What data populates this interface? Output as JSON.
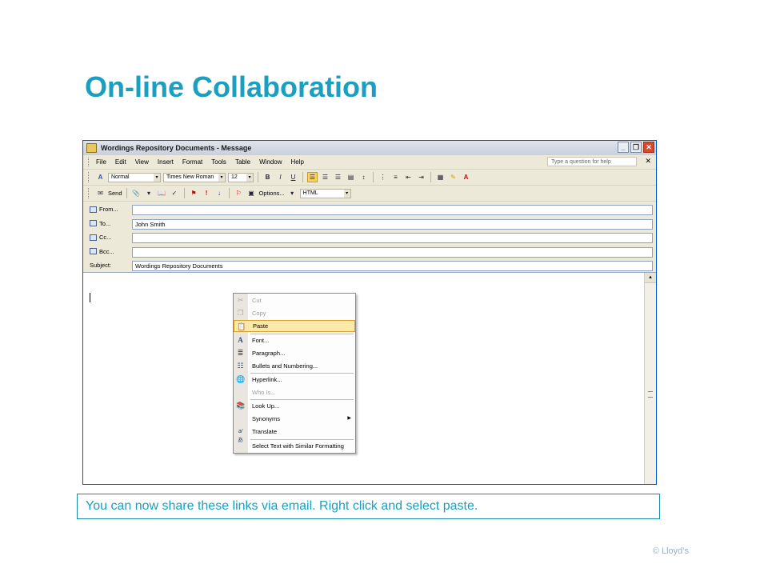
{
  "slide": {
    "title": "On-line Collaboration",
    "caption": "You can now share these links via email. Right click and select paste.",
    "footer": "© Lloyd’s"
  },
  "window": {
    "title": "Wordings Repository Documents - Message",
    "menu": [
      "File",
      "Edit",
      "View",
      "Insert",
      "Format",
      "Tools",
      "Table",
      "Window",
      "Help"
    ],
    "help_placeholder": "Type a question for help",
    "format_toolbar": {
      "style": "Normal",
      "font": "Times New Roman",
      "size": "12",
      "bold": "B",
      "italic": "I",
      "underline": "U"
    },
    "send_toolbar": {
      "send": "Send",
      "options": "Options...",
      "format": "HTML"
    },
    "fields": {
      "from_label": "From...",
      "from_value": "",
      "to_label": "To...",
      "to_value": "John Smith",
      "cc_label": "Cc...",
      "cc_value": "",
      "bcc_label": "Bcc...",
      "bcc_value": "",
      "subject_label": "Subject:",
      "subject_value": "Wordings Repository Documents"
    }
  },
  "context_menu": {
    "items": [
      {
        "label": "Cut",
        "icon": "scissors-icon",
        "enabled": false
      },
      {
        "label": "Copy",
        "icon": "copy-icon",
        "enabled": false
      },
      {
        "label": "Paste",
        "icon": "paste-icon",
        "enabled": true,
        "highlighted": true
      },
      {
        "label": "Font...",
        "icon": "font-icon",
        "enabled": true
      },
      {
        "label": "Paragraph...",
        "icon": "paragraph-icon",
        "enabled": true
      },
      {
        "label": "Bullets and Numbering...",
        "icon": "bullets-icon",
        "enabled": true
      },
      {
        "label": "Hyperlink...",
        "icon": "hyperlink-icon",
        "enabled": true
      },
      {
        "label": "Who Is...",
        "icon": "",
        "enabled": false
      },
      {
        "label": "Look Up...",
        "icon": "lookup-icon",
        "enabled": true
      },
      {
        "label": "Synonyms",
        "icon": "",
        "enabled": true,
        "submenu": true
      },
      {
        "label": "Translate",
        "icon": "translate-icon",
        "enabled": true
      },
      {
        "label": "Select Text with Similar Formatting",
        "icon": "",
        "enabled": true
      }
    ]
  }
}
